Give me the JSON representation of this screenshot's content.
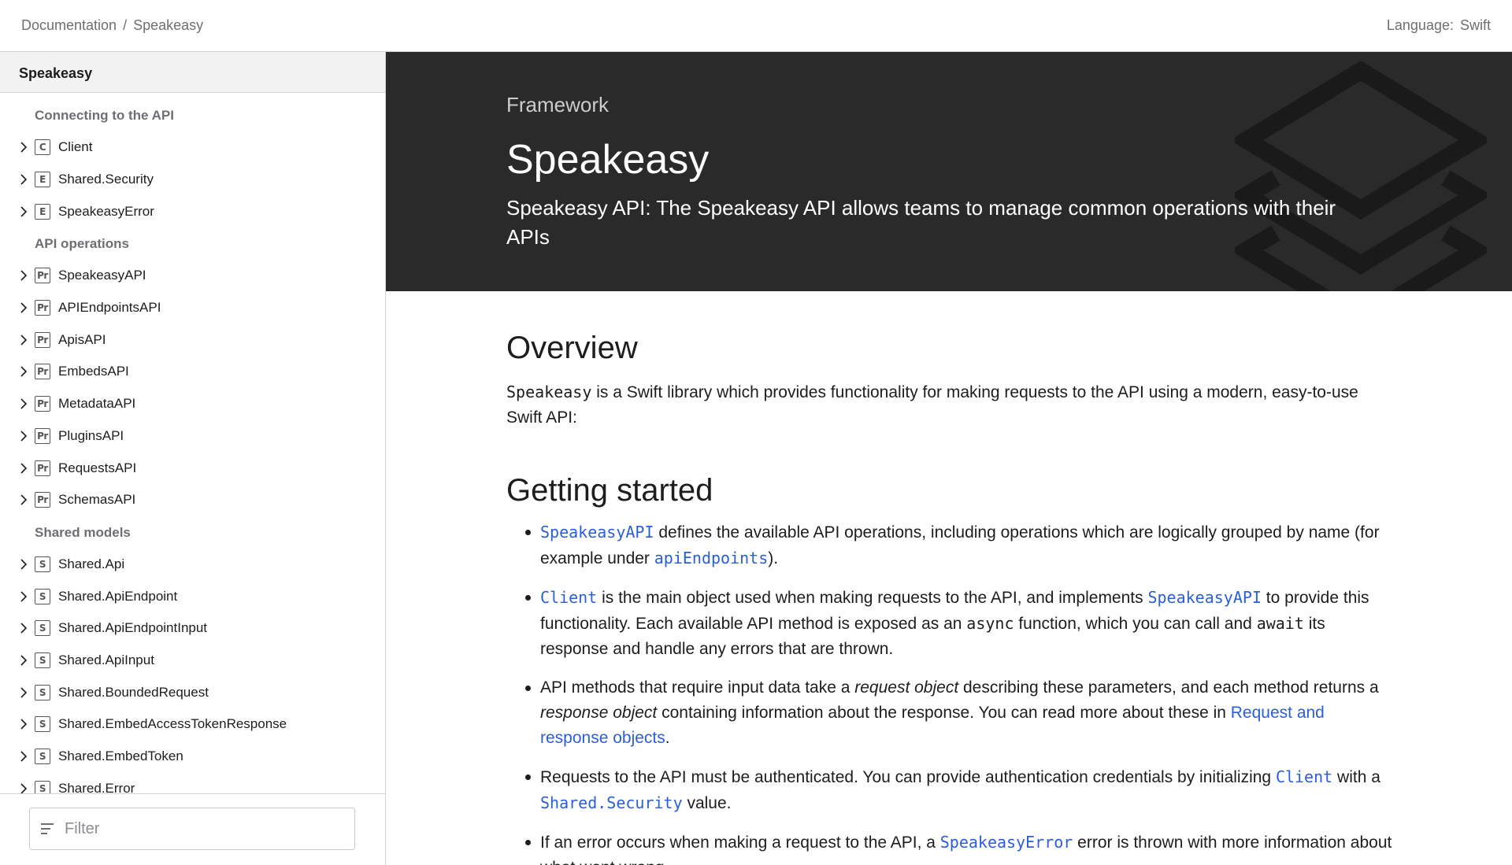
{
  "breadcrumb": {
    "root": "Documentation",
    "separator": "/",
    "current": "Speakeasy"
  },
  "language": {
    "label": "Language:",
    "value": "Swift"
  },
  "sidebar": {
    "title": "Speakeasy",
    "sections": [
      {
        "title": "Connecting to the API",
        "items": [
          {
            "badge": "C",
            "label": "Client"
          },
          {
            "badge": "E",
            "label": "Shared.Security"
          },
          {
            "badge": "E",
            "label": "SpeakeasyError"
          }
        ]
      },
      {
        "title": "API operations",
        "items": [
          {
            "badge": "Pr",
            "label": "SpeakeasyAPI"
          },
          {
            "badge": "Pr",
            "label": "APIEndpointsAPI"
          },
          {
            "badge": "Pr",
            "label": "ApisAPI"
          },
          {
            "badge": "Pr",
            "label": "EmbedsAPI"
          },
          {
            "badge": "Pr",
            "label": "MetadataAPI"
          },
          {
            "badge": "Pr",
            "label": "PluginsAPI"
          },
          {
            "badge": "Pr",
            "label": "RequestsAPI"
          },
          {
            "badge": "Pr",
            "label": "SchemasAPI"
          }
        ]
      },
      {
        "title": "Shared models",
        "items": [
          {
            "badge": "S",
            "label": "Shared.Api"
          },
          {
            "badge": "S",
            "label": "Shared.ApiEndpoint"
          },
          {
            "badge": "S",
            "label": "Shared.ApiEndpointInput"
          },
          {
            "badge": "S",
            "label": "Shared.ApiInput"
          },
          {
            "badge": "S",
            "label": "Shared.BoundedRequest"
          },
          {
            "badge": "S",
            "label": "Shared.EmbedAccessTokenResponse"
          },
          {
            "badge": "S",
            "label": "Shared.EmbedToken"
          },
          {
            "badge": "S",
            "label": "Shared.Error"
          }
        ]
      }
    ],
    "filter_placeholder": "Filter"
  },
  "hero": {
    "eyebrow": "Framework",
    "title": "Speakeasy",
    "abstract": "Speakeasy API: The Speakeasy API allows teams to manage common operations with their APIs"
  },
  "overview": {
    "heading": "Overview",
    "code": "Speakeasy",
    "text": " is a Swift library which provides functionality for making requests to the API using a modern, easy-to-use Swift API:"
  },
  "getting_started": {
    "heading": "Getting started",
    "b1": {
      "sym1": "SpeakeasyAPI",
      "t1": " defines the available API operations, including operations which are logically grouped by name (for example under ",
      "sym2": "apiEndpoints",
      "t2": ")."
    },
    "b2": {
      "sym1": "Client",
      "t1": " is the main object used when making requests to the API, and implements ",
      "sym2": "SpeakeasyAPI",
      "t2": " to provide this functionality. Each available API method is exposed as an ",
      "code1": "async",
      "t3": " function, which you can call and ",
      "code2": "await",
      "t4": " its response and handle any errors that are thrown."
    },
    "b3": {
      "t1": "API methods that require input data take a ",
      "em1": "request object",
      "t2": " describing these parameters, and each method returns a ",
      "em2": "response object",
      "t3": " containing information about the response. You can read more about these in ",
      "link": "Request and response objects",
      "t4": "."
    },
    "b4": {
      "t1": "Requests to the API must be authenticated. You can provide authentication credentials by initializing ",
      "sym1": "Client",
      "t2": " with a ",
      "sym2": "Shared.Security",
      "t3": " value."
    },
    "b5": {
      "t1": "If an error occurs when making a request to the API, a ",
      "sym1": "SpeakeasyError",
      "t2": " error is thrown with more information about what went wrong."
    }
  }
}
